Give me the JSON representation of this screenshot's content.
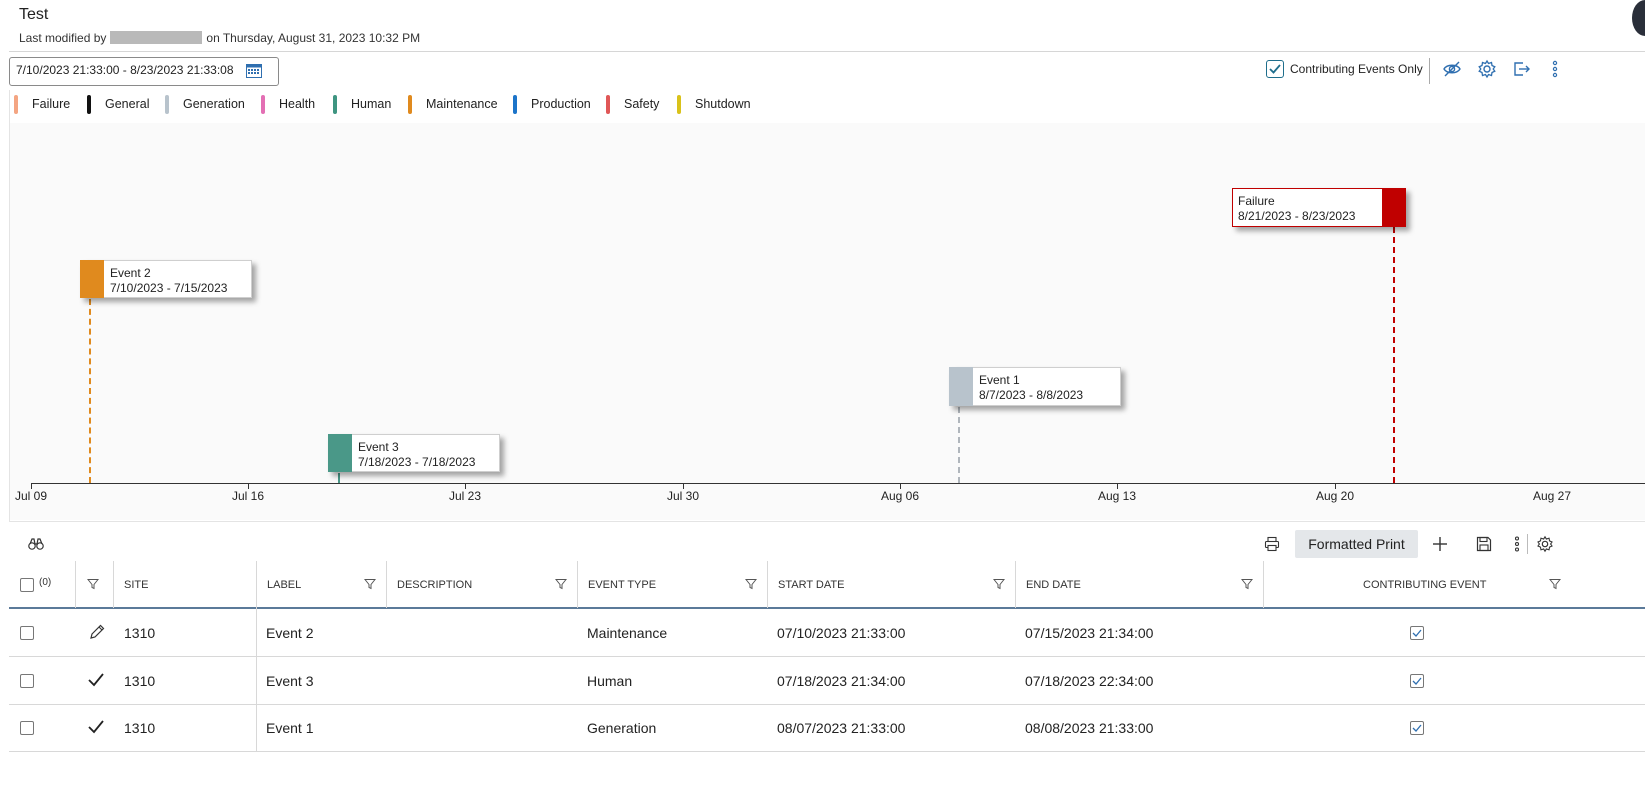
{
  "header": {
    "title": "Test",
    "modified_prefix": "Last modified by",
    "modified_suffix": "on Thursday, August 31, 2023 10:32 PM"
  },
  "toolbar": {
    "date_range": "7/10/2023 21:33:00  -  8/23/2023 21:33:08",
    "contributing_only_label": "Contributing Events Only",
    "contributing_only_checked": true,
    "icons": [
      "calendar-icon",
      "hide-icon",
      "gear-icon",
      "export-icon",
      "more-icon"
    ]
  },
  "legend": [
    {
      "label": "Failure",
      "color": "#f4a582"
    },
    {
      "label": "General",
      "color": "#111111"
    },
    {
      "label": "Generation",
      "color": "#b8c3cc"
    },
    {
      "label": "Health",
      "color": "#e36fb4"
    },
    {
      "label": "Human",
      "color": "#3e9581"
    },
    {
      "label": "Maintenance",
      "color": "#e08a1e"
    },
    {
      "label": "Production",
      "color": "#1c74c9"
    },
    {
      "label": "Safety",
      "color": "#e05757"
    },
    {
      "label": "Shutdown",
      "color": "#d9c21a"
    }
  ],
  "timeline": {
    "axis_ticks": [
      "Jul 09",
      "Jul 16",
      "Jul 23",
      "Jul 30",
      "Aug 06",
      "Aug 13",
      "Aug 20",
      "Aug 27"
    ],
    "events": [
      {
        "title": "Event 2",
        "range": "7/10/2023 - 7/15/2023",
        "color": "#e08a1e"
      },
      {
        "title": "Event 3",
        "range": "7/18/2023 - 7/18/2023",
        "color": "#4a9888"
      },
      {
        "title": "Event 1",
        "range": "8/7/2023 - 8/8/2023",
        "color": "#b8c3cc"
      },
      {
        "title": "Failure",
        "range": "8/21/2023 - 8/23/2023",
        "color": "#c00000"
      }
    ]
  },
  "grid_toolbar": {
    "formatted_print": "Formatted Print"
  },
  "table": {
    "selected_count": "(0)",
    "headers": [
      "SITE",
      "LABEL",
      "DESCRIPTION",
      "EVENT TYPE",
      "START DATE",
      "END DATE",
      "CONTRIBUTING EVENT"
    ],
    "rows": [
      {
        "status": "edit",
        "site": "1310",
        "label": "Event 2",
        "description": "",
        "event_type": "Maintenance",
        "start": "07/10/2023 21:33:00",
        "end": "07/15/2023 21:34:00",
        "contributing": true
      },
      {
        "status": "saved",
        "site": "1310",
        "label": "Event 3",
        "description": "",
        "event_type": "Human",
        "start": "07/18/2023 21:34:00",
        "end": "07/18/2023 22:34:00",
        "contributing": true
      },
      {
        "status": "saved",
        "site": "1310",
        "label": "Event 1",
        "description": "",
        "event_type": "Generation",
        "start": "08/07/2023 21:33:00",
        "end": "08/08/2023 21:33:00",
        "contributing": true
      }
    ]
  }
}
